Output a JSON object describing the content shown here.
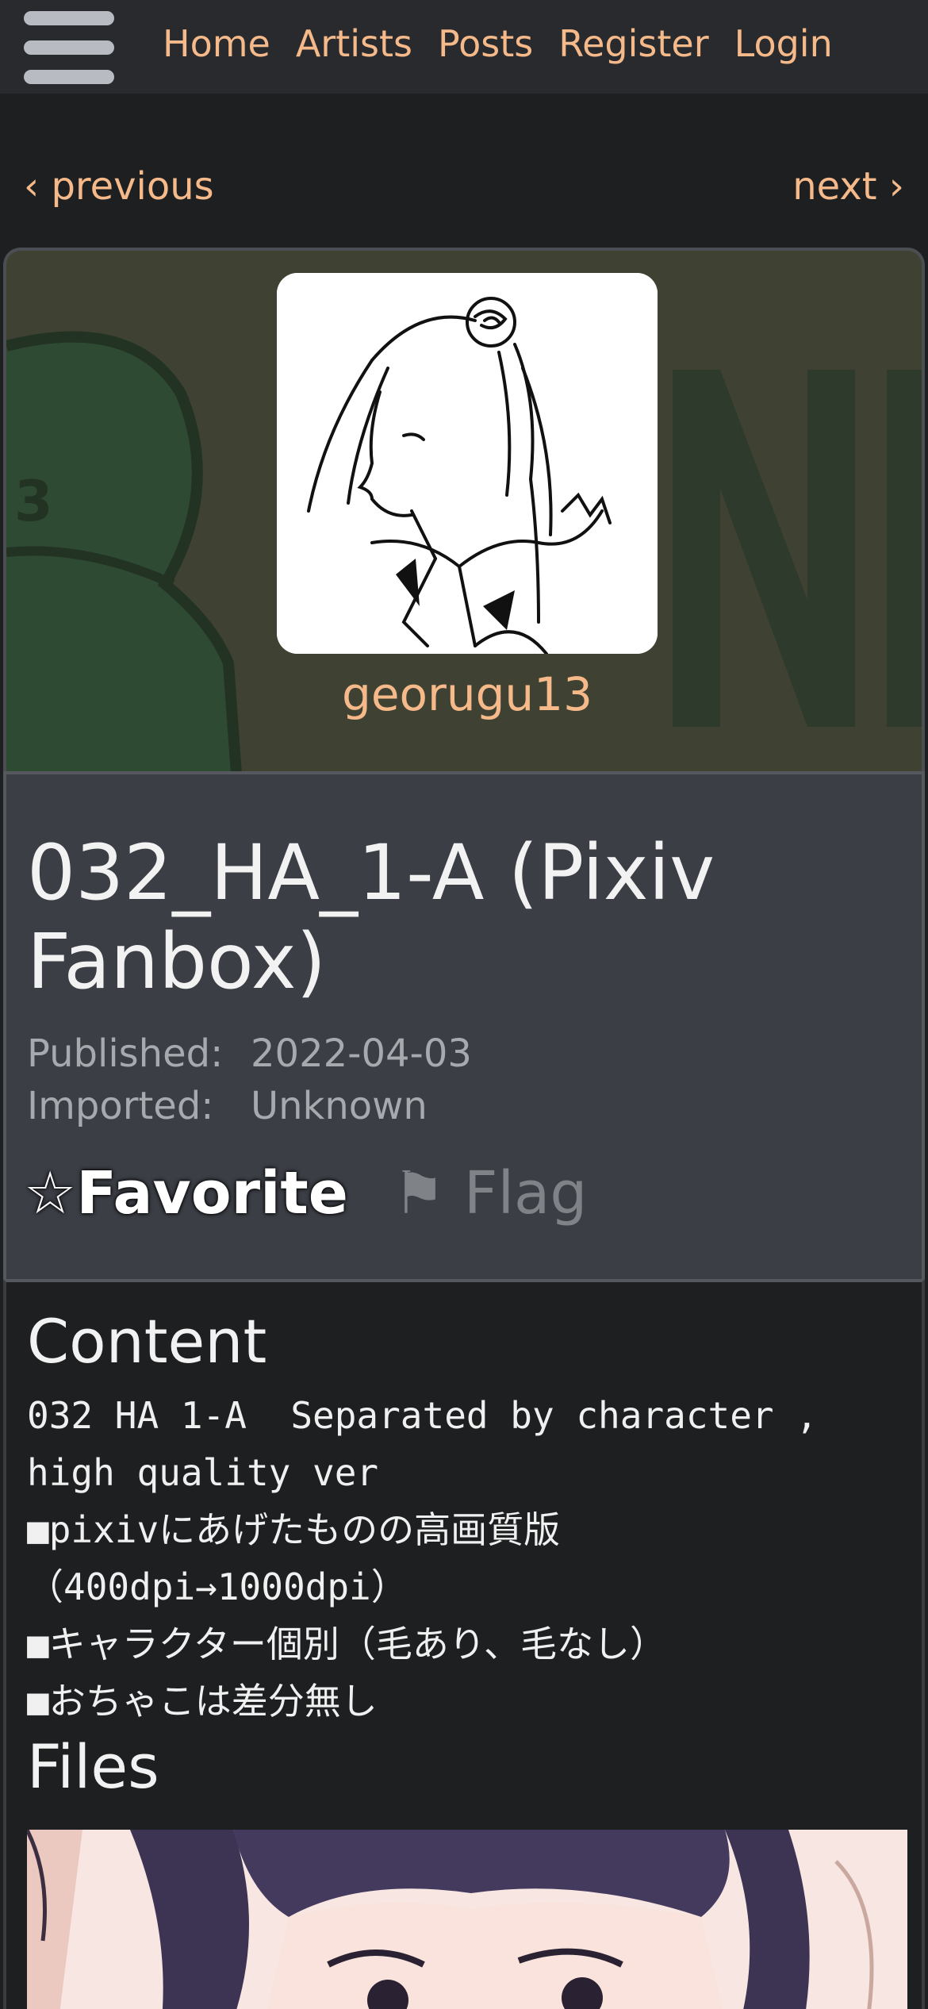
{
  "nav": {
    "items": [
      {
        "label": "Home"
      },
      {
        "label": "Artists"
      },
      {
        "label": "Posts"
      },
      {
        "label": "Register"
      },
      {
        "label": "Login"
      }
    ],
    "menu_icon": "hamburger-menu-icon"
  },
  "pager": {
    "previous": "‹ previous",
    "next": "next ›"
  },
  "artist": {
    "name": "georugu13"
  },
  "post": {
    "title": "032_HA_1-A (Pixiv Fanbox)",
    "published_label": "Published:",
    "published_value": "2022-04-03",
    "imported_label": "Imported:",
    "imported_value": "Unknown",
    "favorite_icon": "☆",
    "favorite_label": "Favorite",
    "flag_icon": "⚑",
    "flag_label": "Flag"
  },
  "content": {
    "heading": "Content",
    "body": "032 HA 1-A  Separated by character , high quality ver\n■pixivにあげたものの高画質版（400dpi→1000dpi）\n■キャラクター個別（毛あり、毛なし）\n■おちゃこは差分無し",
    "files_heading": "Files"
  },
  "colors": {
    "accent": "#f5b98a",
    "nav_bg": "#282a2e",
    "page_bg": "#1d1f21",
    "info_bg": "#3b3e45",
    "banner_bg": "#3f4232"
  }
}
